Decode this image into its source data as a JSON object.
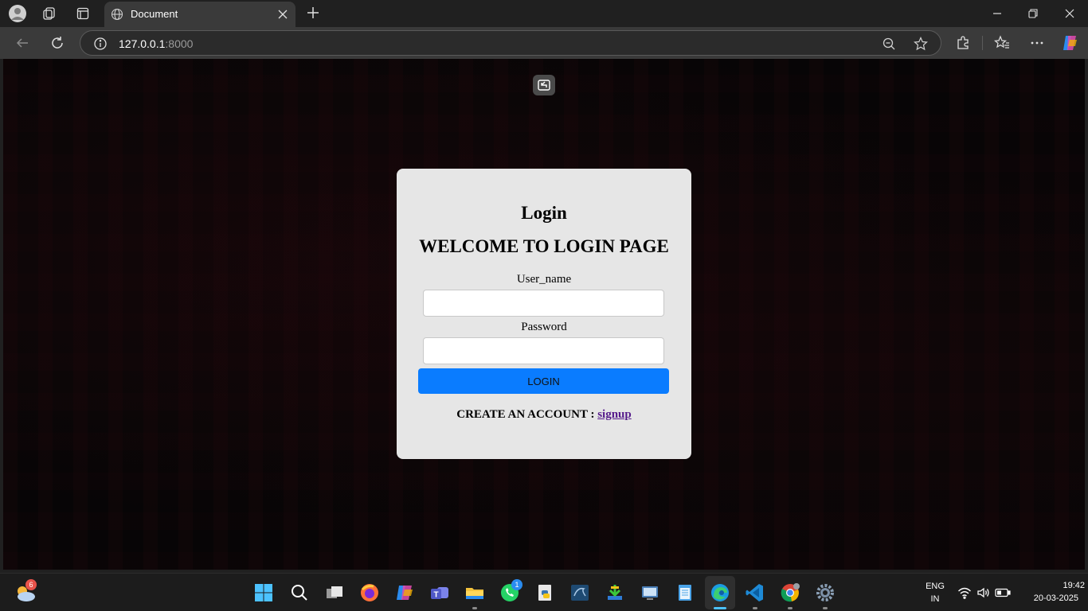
{
  "browser": {
    "tab": {
      "title": "Document"
    },
    "address": {
      "host": "127.0.0.1",
      "port": ":8000"
    }
  },
  "page": {
    "heading": "Login",
    "welcome": "WELCOME TO LOGIN PAGE",
    "username_label": "User_name",
    "username_value": "",
    "password_label": "Password",
    "password_value": "",
    "login_button": "LOGIN",
    "create_account_text": "CREATE AN ACCOUNT : ",
    "signup_link": "signup"
  },
  "taskbar": {
    "weather_badge": "6",
    "whatsapp_badge": "1",
    "language": "ENG",
    "region": "IN",
    "time": "19:42",
    "date": "20-03-2025"
  },
  "colors": {
    "accent_button": "#0a7cff",
    "card_bg": "#e6e6e6",
    "link": "#551a8b",
    "active_indicator": "#4cc2ff"
  }
}
